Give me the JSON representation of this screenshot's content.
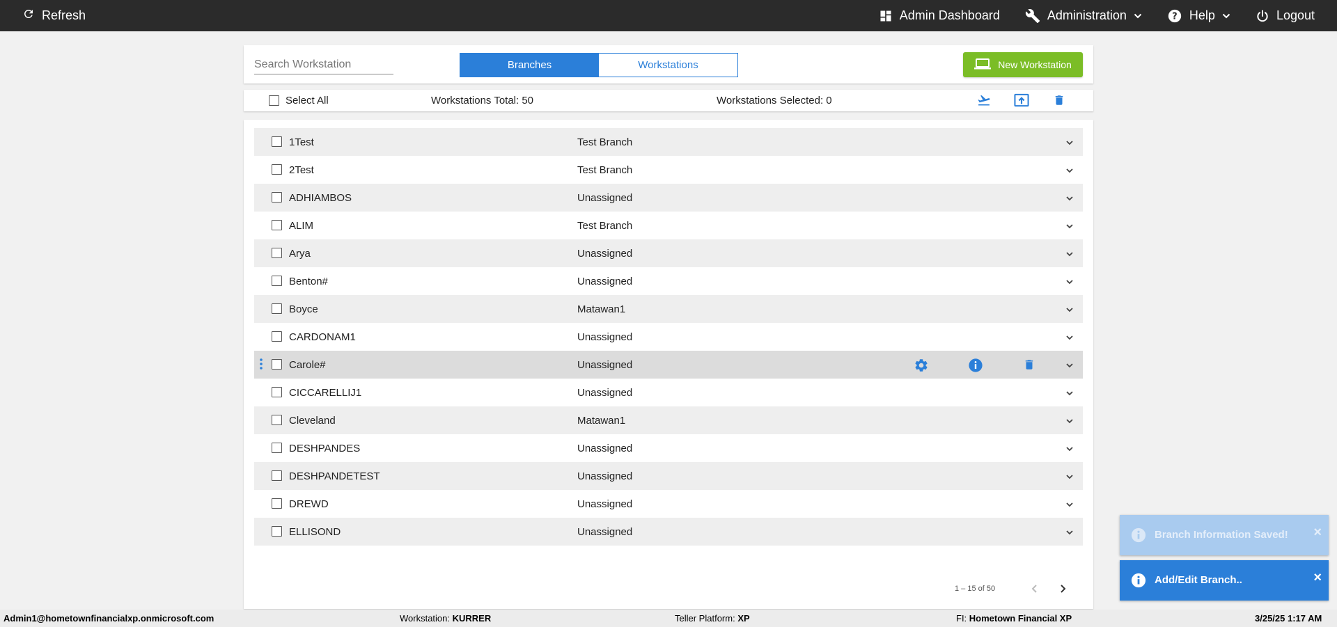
{
  "topbar": {
    "refresh_label": "Refresh",
    "nav": {
      "admin_dashboard": "Admin Dashboard",
      "administration": "Administration",
      "help": "Help",
      "logout": "Logout"
    }
  },
  "toolbar": {
    "search_placeholder": "Search Workstation",
    "toggle": {
      "active": "Branches",
      "inactive": "Workstations"
    },
    "new_workstation": "New Workstation"
  },
  "selection": {
    "select_all": "Select All",
    "total": "Workstations Total: 50",
    "selected": "Workstations Selected: 0",
    "action_icons": [
      "flight-takeoff-icon",
      "upload-icon",
      "trash-icon"
    ]
  },
  "rows": [
    {
      "name": "1Test",
      "branch": "Test Branch"
    },
    {
      "name": "2Test",
      "branch": "Test Branch"
    },
    {
      "name": "ADHIAMBOS",
      "branch": "Unassigned"
    },
    {
      "name": "ALIM",
      "branch": "Test Branch"
    },
    {
      "name": "Arya",
      "branch": "Unassigned"
    },
    {
      "name": "Benton#",
      "branch": "Unassigned"
    },
    {
      "name": "Boyce",
      "branch": "Matawan1"
    },
    {
      "name": "CARDONAM1",
      "branch": "Unassigned"
    },
    {
      "name": "Carole#",
      "branch": "Unassigned"
    },
    {
      "name": "CICCARELLIJ1",
      "branch": "Unassigned"
    },
    {
      "name": "Cleveland",
      "branch": "Matawan1"
    },
    {
      "name": "DESHPANDES",
      "branch": "Unassigned"
    },
    {
      "name": "DESHPANDETEST",
      "branch": "Unassigned"
    },
    {
      "name": "DREWD",
      "branch": "Unassigned"
    },
    {
      "name": "ELLISOND",
      "branch": "Unassigned"
    }
  ],
  "hover_row_index": 8,
  "pagination": {
    "range": "1 – 15 of 50"
  },
  "toasts": [
    {
      "text": "Branch Information Saved!",
      "close": "×"
    },
    {
      "text": "Add/Edit Branch..",
      "close": "×"
    }
  ],
  "statusbar": {
    "user": "Admin1@hometownfinancialxp.onmicrosoft.com",
    "workstation_label": "Workstation: ",
    "workstation_value": "KURRER",
    "platform_label": "Teller Platform: ",
    "platform_value": "XP",
    "fi_label": "FI: ",
    "fi_value": "Hometown Financial XP",
    "datetime": "3/25/25 1:17 AM"
  },
  "colors": {
    "topbar": "#2b2b2b",
    "accent": "#2b7fd9",
    "new_button": "#7bbd26"
  }
}
